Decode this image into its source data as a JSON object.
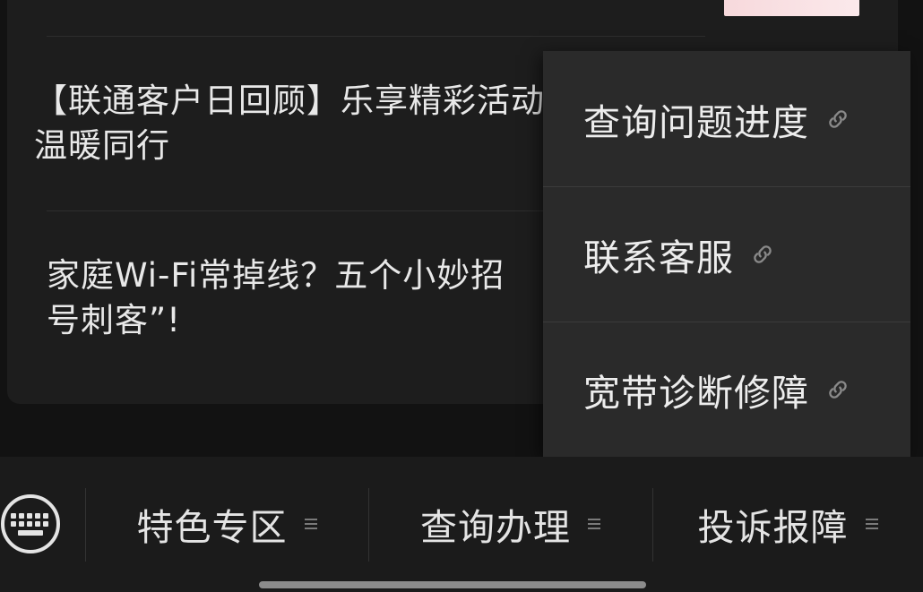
{
  "news": {
    "items": [
      {
        "title": "【联通客户日回顾】乐享精彩活动\n温暖同行"
      },
      {
        "title": "家庭Wi-Fi常掉线？五个小妙招\n号刺客”!"
      }
    ]
  },
  "popup_menu": {
    "items": [
      {
        "label": "查询问题进度",
        "icon": "link-icon"
      },
      {
        "label": "联系客服",
        "icon": "link-icon"
      },
      {
        "label": "宽带诊断修障",
        "icon": "link-icon"
      }
    ]
  },
  "tabbar": {
    "keyboard_icon": "keyboard-icon",
    "tabs": [
      {
        "label": "特色专区",
        "icon": "menu-lines-icon"
      },
      {
        "label": "查询办理",
        "icon": "menu-lines-icon"
      },
      {
        "label": "投诉报障",
        "icon": "menu-lines-icon"
      }
    ]
  },
  "colors": {
    "background": "#121212",
    "card": "#1d1d1d",
    "menu": "#2a2a2a",
    "tabbar": "#1b1b1b",
    "text": "#e8e8e8"
  }
}
